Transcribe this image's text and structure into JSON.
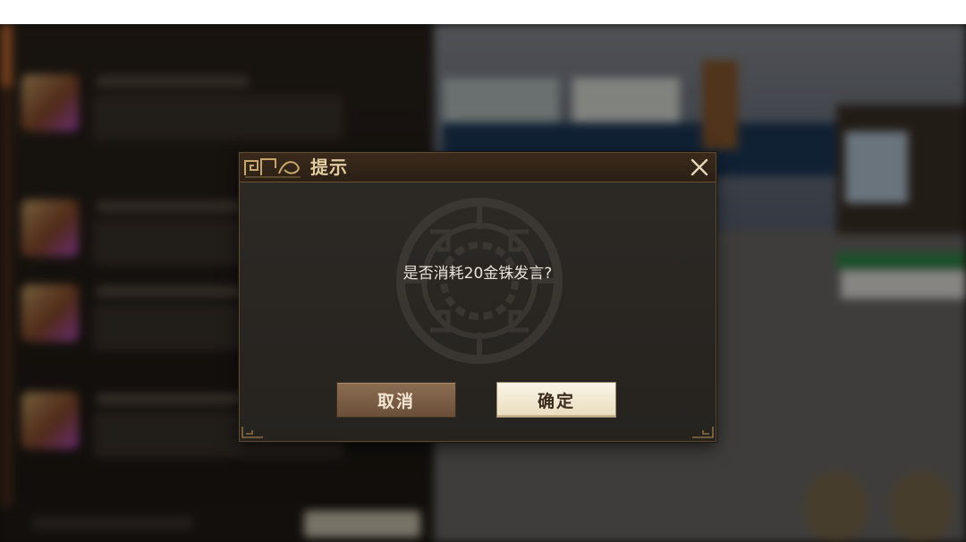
{
  "dialog": {
    "title": "提示",
    "message": "是否消耗20金铢发言?",
    "cancel_label": "取消",
    "confirm_label": "确定",
    "close_icon": "close-icon"
  },
  "colors": {
    "title_text": "#e3cca0",
    "confirm_bg": "#f6efdd",
    "cancel_bg": "#7a5e46"
  }
}
